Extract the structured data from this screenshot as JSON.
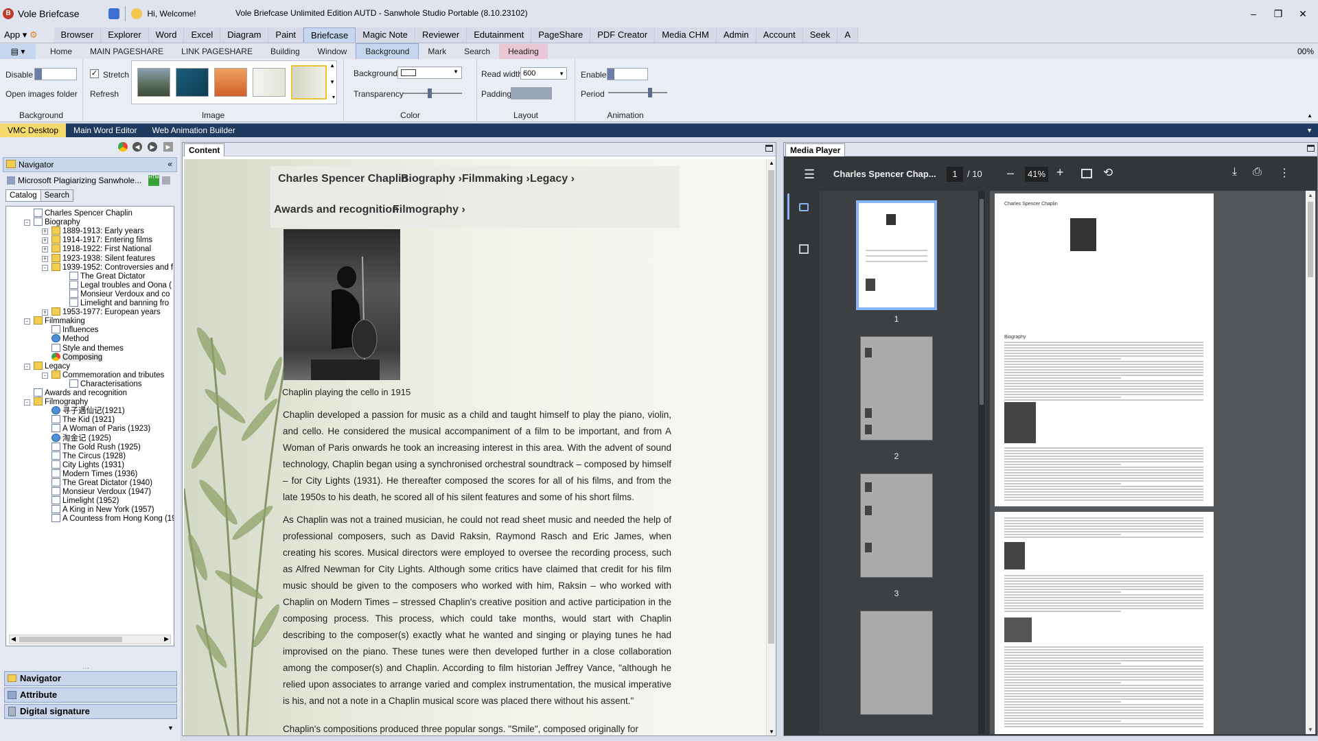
{
  "titlebar": {
    "app_name": "Vole Briefcase",
    "welcome": "Hi, Welcome!",
    "window_title": "Vole Briefcase Unlimited Edition AUTD - Sanwhole Studio Portable (8.10.23102)"
  },
  "menu": {
    "app_label": "App",
    "items": [
      "Browser",
      "Explorer",
      "Word",
      "Excel",
      "Diagram",
      "Paint",
      "Briefcase",
      "Magic Note",
      "Reviewer",
      "Edutainment",
      "PageShare",
      "PDF Creator",
      "Media CHM",
      "Admin",
      "Account",
      "Seek",
      "A"
    ],
    "active": "Briefcase"
  },
  "subtabs": {
    "items": [
      "Home",
      "MAIN PAGESHARE",
      "LINK PAGESHARE",
      "Building",
      "Window",
      "Background",
      "Mark",
      "Search",
      "Heading"
    ],
    "active": "Background",
    "zoom": "00%"
  },
  "ribbon": {
    "background": {
      "disable": "Disable",
      "open_images": "Open images folder",
      "label": "Background"
    },
    "image": {
      "stretch": "Stretch",
      "refresh": "Refresh",
      "label": "Image"
    },
    "color": {
      "background": "Background",
      "transparency": "Transparency",
      "label": "Color"
    },
    "layout": {
      "read_width": "Read width",
      "read_width_value": "600",
      "padding": "Padding",
      "label": "Layout"
    },
    "animation": {
      "enable": "Enable",
      "period": "Period",
      "label": "Animation"
    }
  },
  "doctabs": {
    "items": [
      "VMC Desktop",
      "Main Word Editor",
      "Web Animation Builder"
    ],
    "active": "VMC Desktop"
  },
  "navigator": {
    "title": "Navigator",
    "doc_title": "Microsoft  Plagiarizing Sanwhole...",
    "tabs": [
      "Catalog",
      "Search"
    ],
    "tree": [
      {
        "label": "Charles Spencer Chaplin",
        "level": 1,
        "icon": "page"
      },
      {
        "label": "Biography",
        "level": 1,
        "icon": "page",
        "exp": "-"
      },
      {
        "label": "1889-1913: Early years",
        "level": 2,
        "icon": "folder",
        "exp": "+"
      },
      {
        "label": "1914-1917: Entering films",
        "level": 2,
        "icon": "folder",
        "exp": "+"
      },
      {
        "label": "1918-1922: First National",
        "level": 2,
        "icon": "folder",
        "exp": "+"
      },
      {
        "label": "1923-1938: Silent features",
        "level": 2,
        "icon": "folder",
        "exp": "+"
      },
      {
        "label": "1939-1952: Controversies and f",
        "level": 2,
        "icon": "folder",
        "exp": "-"
      },
      {
        "label": "The Great Dictator",
        "level": 3,
        "icon": "page"
      },
      {
        "label": "Legal troubles and Oona (",
        "level": 3,
        "icon": "page"
      },
      {
        "label": "Monsieur Verdoux and co",
        "level": 3,
        "icon": "page"
      },
      {
        "label": "Limelight and banning fro",
        "level": 3,
        "icon": "page"
      },
      {
        "label": "1953-1977: European years",
        "level": 2,
        "icon": "folder",
        "exp": "+"
      },
      {
        "label": "Filmmaking",
        "level": 1,
        "icon": "folder",
        "exp": "-"
      },
      {
        "label": "Influences",
        "level": 2,
        "icon": "page"
      },
      {
        "label": "Method",
        "level": 2,
        "icon": "web"
      },
      {
        "label": "Style and themes",
        "level": 2,
        "icon": "page"
      },
      {
        "label": "Composing",
        "level": 2,
        "icon": "chrome"
      },
      {
        "label": "Legacy",
        "level": 1,
        "icon": "folder",
        "exp": "-"
      },
      {
        "label": "Commemoration and tributes",
        "level": 2,
        "icon": "folder",
        "exp": "-"
      },
      {
        "label": "Characterisations",
        "level": 3,
        "icon": "page"
      },
      {
        "label": "Awards and recognition",
        "level": 1,
        "icon": "page"
      },
      {
        "label": "Filmography",
        "level": 1,
        "icon": "folder",
        "exp": "-"
      },
      {
        "label": "寻子遇仙记(1921)",
        "level": 2,
        "icon": "web"
      },
      {
        "label": "The Kid (1921)",
        "level": 2,
        "icon": "page"
      },
      {
        "label": "A Woman of Paris (1923)",
        "level": 2,
        "icon": "page"
      },
      {
        "label": "淘金记 (1925)",
        "level": 2,
        "icon": "web"
      },
      {
        "label": "The Gold Rush (1925)",
        "level": 2,
        "icon": "page"
      },
      {
        "label": "The Circus (1928)",
        "level": 2,
        "icon": "page"
      },
      {
        "label": "City Lights (1931)",
        "level": 2,
        "icon": "page"
      },
      {
        "label": "Modern Times (1936)",
        "level": 2,
        "icon": "page"
      },
      {
        "label": "The Great Dictator (1940)",
        "level": 2,
        "icon": "page"
      },
      {
        "label": "Monsieur Verdoux (1947)",
        "level": 2,
        "icon": "page"
      },
      {
        "label": "Limelight (1952)",
        "level": 2,
        "icon": "page"
      },
      {
        "label": "A King in New York (1957)",
        "level": 2,
        "icon": "page"
      },
      {
        "label": "A Countess from Hong Kong (19",
        "level": 2,
        "icon": "page"
      }
    ],
    "panels": [
      "Navigator",
      "Attribute",
      "Digital signature"
    ]
  },
  "content": {
    "tab": "Content",
    "nav_title": "Charles Spencer Chaplin",
    "nav_links": [
      "Biography ›",
      "Filmmaking ›",
      "Legacy ›",
      "Awards and recognition",
      "Filmography ›"
    ],
    "caption": "Chaplin playing the cello in 1915",
    "para1": "Chaplin developed a passion for music as a child and taught himself to play the piano, violin, and cello. He considered the musical accompaniment of a film to be important, and from A Woman of Paris onwards he took an increasing interest in this area. With the advent of sound technology, Chaplin began using a synchronised orchestral soundtrack – composed by himself – for City Lights (1931). He thereafter composed the scores for all of his films, and from the late 1950s to his death, he scored all of his silent features and some of his short films.",
    "para2": "As Chaplin was not a trained musician, he could not read sheet music and needed the help of professional composers, such as David Raksin, Raymond Rasch and Eric James, when creating his scores. Musical directors were employed to oversee the recording process, such as Alfred Newman for City Lights. Although some critics have claimed that credit for his film music should be given to the composers who worked with him, Raksin – who worked with Chaplin on Modern Times – stressed Chaplin's creative position and active participation in the composing process. This process, which could take months, would start with Chaplin describing to the composer(s) exactly what he wanted and singing or playing tunes he had improvised on the piano. These tunes were then developed further in a close collaboration among the composer(s) and Chaplin. According to film historian Jeffrey Vance, \"although he relied upon associates to arrange varied and complex instrumentation, the musical imperative is his, and not a note in a Chaplin musical score was placed there without his assent.\"",
    "para3": "Chaplin's compositions produced three popular songs. \"Smile\", composed originally for"
  },
  "media": {
    "tab": "Media Player",
    "doc_title": "Charles Spencer Chap...",
    "page_current": "1",
    "page_total": "/ 10",
    "zoom": "41%",
    "thumb_labels": [
      "1",
      "2",
      "3"
    ],
    "page_header": "Charles Spencer Chaplin",
    "page_section": "Biography"
  }
}
